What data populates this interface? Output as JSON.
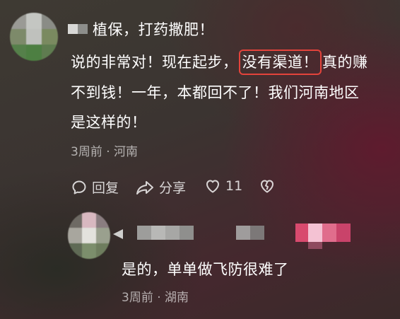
{
  "comment": {
    "first_line": "植保，打药撒肥！",
    "body_part1": "说的非常对！现在起步，",
    "body_highlight": "没有渠道！",
    "body_part2": "真的赚",
    "body_line2": "不到钱！一年，本都回不了！我们河南地区",
    "body_line3": "是这样的！",
    "meta": "3周前 · 河南",
    "actions": {
      "reply_label": "回复",
      "share_label": "分享",
      "like_count": "11"
    }
  },
  "reply": {
    "text": "是的，单单做飞防很难了",
    "meta": "3周前 · 湖南"
  },
  "colors": {
    "highlight_border": "#e4433b",
    "meta_text": "rgba(255,255,255,0.62)"
  },
  "icons": {
    "reply": "speech-bubble-icon",
    "share": "share-arrow-icon",
    "like": "heart-icon",
    "dislike": "broken-heart-icon"
  }
}
